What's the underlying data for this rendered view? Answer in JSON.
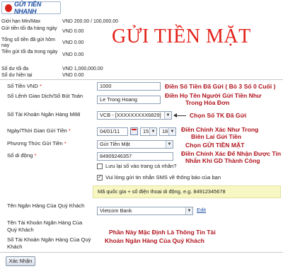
{
  "logo": {
    "text": "GỬI TIỀN NHANH"
  },
  "limits": [
    {
      "label": "Giới hạn Min/Max",
      "value": "VND 200.00 / 100,000.00"
    },
    {
      "label": "Gửi tiền tối đa hàng ngày",
      "value": "VND 0.00"
    },
    {
      "label": "Tổng số tiền đã gửi hôm nay",
      "value": "VND 0.00"
    },
    {
      "label": "Tiền gửi tối đa trong ngày",
      "value": "VND 0.00"
    },
    {
      "label": "Số dư tối đa",
      "value": "VND 1,000,000.00"
    },
    {
      "label": "Số dư hiện tại",
      "value": "VND 0.00"
    }
  ],
  "page_title": "GỬI TIỀN MẶT",
  "form": {
    "amount": {
      "label": "Số Tiền VND",
      "value": "1000",
      "note": "Điền Số Tiền Đã Gửi ( Bỏ 3 Số 0 Cuối )"
    },
    "transaction": {
      "label": "Số Lệnh Giao Dịch/Số Bút Toán",
      "value": "Le Trong Hoang",
      "note": "Điền Họ Tên Người Gửi Tiền Như Trong Hóa Đơn"
    },
    "bank_account": {
      "label": "Số Tài Khoản Ngân Hàng M88",
      "value": "VCB - [XXXXXXXXX6829]",
      "note": "Chọn Số TK Đã Gửi"
    },
    "datetime": {
      "label": "Ngày/Thời Gian Gửi Tiền",
      "date": "04/01/11",
      "hour": "15",
      "minute": "18",
      "note": "Điền Chính Xác Như Trong Biên Lai Gửi Tiền"
    },
    "method": {
      "label": "Phương Thức Gửi Tiền",
      "value": "Gửi Tiền Mặt",
      "note": "Chọn GỬI TIỀN MẶT"
    },
    "phone": {
      "label": "Số di động",
      "value": "84909246357",
      "note": "Điền Chính Xác Để Nhận Được Tin Nhắn Khi GD Thành Công"
    },
    "save_phone": {
      "label": "Lưu lại số vào trang cá nhân?",
      "checked": false
    },
    "sms_notify": {
      "label": "Vui lòng gửi tin nhắn SMS về thông báo của bạn",
      "checked": true
    },
    "hint": "Mã quốc gia + số điện thoại di động, e.g. 84912345678",
    "customer_bank": {
      "label": "Tên Ngân Hàng Của Quý Khách",
      "value": "Vietcom Bank",
      "edit": "Edit"
    },
    "customer_account_name": {
      "label": "Tên Tài Khoản Ngân Hàng Của Quý Khách"
    },
    "customer_account_number": {
      "label": "Số Tài Khoản Ngân Hàng Của Quý Khách"
    },
    "default_note": "Phần Này Mặc Định Là Thông Tin Tài Khoản Ngân Hàng Của Quý Khách",
    "required_mark": "*",
    "submit": "Xác Nhận"
  },
  "colors": {
    "accent_red": "#e3211a",
    "note_red": "#b0141d",
    "link_blue": "#1d4fa3",
    "hint_bg": "#f7f7c3"
  }
}
